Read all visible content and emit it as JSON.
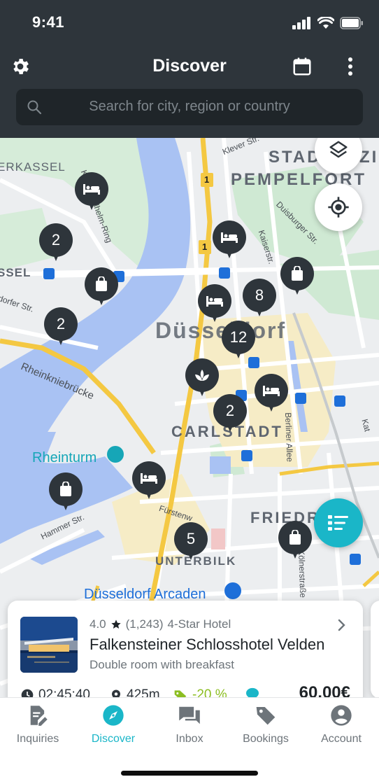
{
  "status_bar": {
    "time": "9:41"
  },
  "header": {
    "title": "Discover",
    "search_placeholder": "Search for city, region or country",
    "icons": [
      "gear-icon",
      "calendar-icon",
      "more-vertical-icon",
      "search-icon"
    ]
  },
  "map": {
    "labels": {
      "erkassel": "ERKASSEL",
      "ssel": "SSEL",
      "stadt": "STAD",
      "zi": "ZI",
      "pempelfort": "PEMPELFORT",
      "duesseldorf": "Düsseldorf",
      "carlstadt": "CARLSTADT",
      "friedr": "FRIEDR",
      "unterbilk": "UNTERBILK",
      "rheinturm": "Rheinturm",
      "arcaden": "Düsseldorf Arcaden",
      "rheinkniebruecke": "Rheinkniebrücke",
      "kleverstr": "Klever Str.",
      "kaiserstr": "Kaiserstr.",
      "duisburgerstr": "Duisburger Str.",
      "dorferstr": "dorfer Str.",
      "hammerstr": "Hammer Str.",
      "fuerstenw": "Fürstenw",
      "berlinerallee": "Berliner Allee",
      "kolnerstr": "Kölnerstraße",
      "kaiserringring": "Kaiser-Wilhelm-Ring",
      "road1a": "1",
      "road1b": "1",
      "kat": "Kat"
    },
    "cluster_counts": [
      "2",
      "2",
      "8",
      "12",
      "2",
      "5"
    ],
    "pin_icons": [
      "bed-icon",
      "shopping-bag-icon",
      "spa-icon"
    ]
  },
  "hotel_card": {
    "rating": "4.0",
    "reviews": "(1,243)",
    "category": "4-Star Hotel",
    "name": "Falkensteiner Schlosshotel Velden",
    "room": "Double room with breakfast",
    "time": "02:45:40",
    "distance": "425m",
    "discount": "-20 %",
    "price": "60,00€"
  },
  "tabs": [
    {
      "label": "Inquiries",
      "icon": "edit-document-icon",
      "active": false
    },
    {
      "label": "Discover",
      "icon": "compass-icon",
      "active": true
    },
    {
      "label": "Inbox",
      "icon": "chat-icon",
      "active": false
    },
    {
      "label": "Bookings",
      "icon": "tag-icon",
      "active": false
    },
    {
      "label": "Account",
      "icon": "account-icon",
      "active": false
    }
  ],
  "colors": {
    "header_bg": "#2e353b",
    "accent": "#1ab6c8",
    "pin": "#2e353b",
    "water": "#a9c2f3",
    "park": "#bfe3c4",
    "highway": "#f4c842",
    "discount": "#8cbe22"
  }
}
